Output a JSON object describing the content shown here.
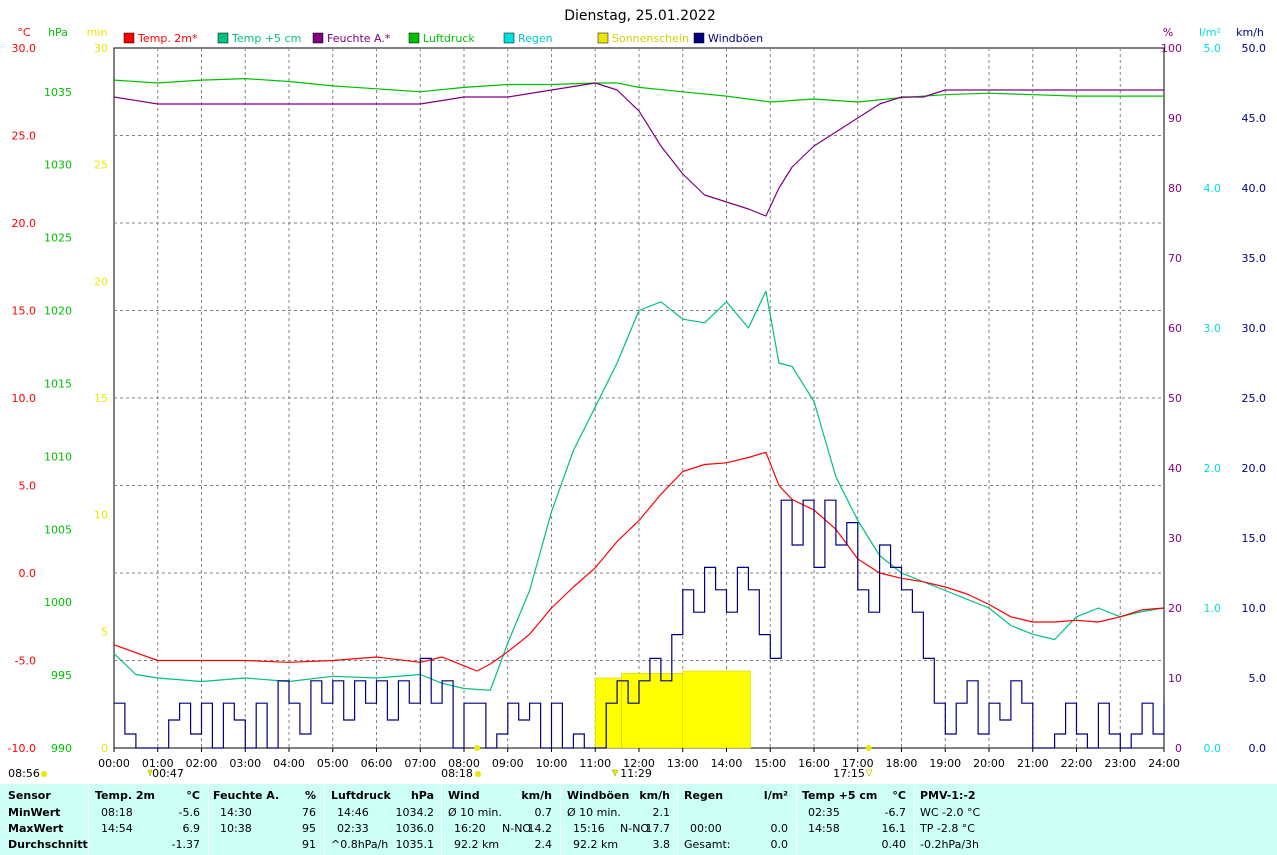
{
  "chart_data": {
    "type": "line",
    "title": "Dienstag, 25.01.2022",
    "axes": {
      "temp": {
        "unit": "°C",
        "ticks": [
          "-10.0",
          "-5.0",
          "0.0",
          "5.0",
          "10.0",
          "15.0",
          "20.0",
          "25.0",
          "30.0"
        ],
        "color": "#ff0000",
        "range": [
          -10,
          30
        ]
      },
      "pressure": {
        "unit": "hPa",
        "ticks": [
          "990",
          "995",
          "1000",
          "1005",
          "1010",
          "1015",
          "1020",
          "1025",
          "1030",
          "1035"
        ],
        "color": "#00c000",
        "range": [
          990,
          1038
        ]
      },
      "sunshine": {
        "unit": "min",
        "ticks": [
          "0",
          "5",
          "10",
          "15",
          "20",
          "25",
          "30"
        ],
        "color": "#e8e800",
        "range": [
          0,
          30
        ]
      },
      "humidity": {
        "unit": "%",
        "ticks": [
          "0",
          "10",
          "20",
          "30",
          "40",
          "50",
          "60",
          "70",
          "80",
          "90",
          "100"
        ],
        "color": "#800080",
        "range": [
          0,
          100
        ]
      },
      "rain": {
        "unit": "l/m²",
        "ticks": [
          "0.0",
          "1.0",
          "2.0",
          "3.0",
          "4.0",
          "5.0"
        ],
        "color": "#00e0e0",
        "range": [
          0,
          5
        ]
      },
      "wind": {
        "unit": "km/h",
        "ticks": [
          "0.0",
          "5.0",
          "10.0",
          "15.0",
          "20.0",
          "25.0",
          "30.0",
          "35.0",
          "40.0",
          "45.0",
          "50.0"
        ],
        "color": "#000080",
        "range": [
          0,
          50
        ]
      }
    },
    "x_ticks": [
      "00:00",
      "01:00",
      "02:00",
      "03:00",
      "04:00",
      "05:00",
      "06:00",
      "07:00",
      "08:00",
      "09:00",
      "10:00",
      "11:00",
      "12:00",
      "13:00",
      "14:00",
      "15:00",
      "16:00",
      "17:00",
      "18:00",
      "19:00",
      "20:00",
      "21:00",
      "22:00",
      "23:00",
      "24:00"
    ],
    "legend": [
      {
        "name": "Temp. 2m*",
        "color": "#ff0000"
      },
      {
        "name": "Temp +5 cm",
        "color": "#00c080"
      },
      {
        "name": "Feuchte A.*",
        "color": "#800080"
      },
      {
        "name": "Luftdruck",
        "color": "#00c000"
      },
      {
        "name": "Regen",
        "color": "#00e0e0"
      },
      {
        "name": "Sonnenschein",
        "color": "#e8e800"
      },
      {
        "name": "Windböen",
        "color": "#000080"
      }
    ],
    "sun_markers": [
      {
        "label": "08:56",
        "time": "08:56"
      },
      {
        "label": "00:47",
        "time": "00:47"
      },
      {
        "label": "08:18",
        "time": "08:18"
      },
      {
        "label": "11:29",
        "time": "11:29"
      },
      {
        "label": "17:15",
        "time": "17:15"
      }
    ],
    "series": [
      {
        "name": "Temp. 2m*",
        "axis": "temp",
        "color": "#ff0000",
        "x": [
          0,
          1,
          2,
          3,
          4,
          5,
          6,
          7,
          7.5,
          8,
          8.3,
          8.6,
          9,
          9.5,
          10,
          10.5,
          11,
          11.5,
          12,
          12.5,
          13,
          13.5,
          14,
          14.5,
          14.9,
          15.2,
          15.5,
          16,
          16.5,
          17,
          17.5,
          18,
          18.5,
          19,
          19.5,
          20,
          20.5,
          21,
          21.5,
          22,
          22.5,
          23,
          23.5,
          24
        ],
        "y": [
          -4.1,
          -5.0,
          -5.0,
          -5.0,
          -5.1,
          -5.0,
          -4.8,
          -5.1,
          -4.8,
          -5.3,
          -5.6,
          -5.2,
          -4.5,
          -3.5,
          -2.0,
          -0.8,
          0.3,
          1.8,
          3.0,
          4.5,
          5.8,
          6.2,
          6.3,
          6.6,
          6.9,
          5.0,
          4.2,
          3.6,
          2.5,
          0.8,
          0.0,
          -0.3,
          -0.5,
          -0.8,
          -1.2,
          -1.8,
          -2.5,
          -2.8,
          -2.8,
          -2.7,
          -2.8,
          -2.5,
          -2.1,
          -2.0
        ]
      },
      {
        "name": "Temp +5 cm",
        "axis": "temp",
        "color": "#00c080",
        "x": [
          0,
          0.5,
          1,
          2,
          3,
          4,
          5,
          6,
          7,
          7.5,
          8,
          8.6,
          9,
          9.5,
          10,
          10.5,
          11,
          11.5,
          12,
          12.5,
          13,
          13.5,
          14,
          14.5,
          14.9,
          15.2,
          15.5,
          16,
          16.5,
          17,
          17.5,
          18,
          18.5,
          19,
          19.5,
          20,
          20.5,
          21,
          21.5,
          22,
          22.5,
          23,
          23.5,
          24
        ],
        "y": [
          -4.6,
          -5.8,
          -6.0,
          -6.2,
          -6.0,
          -6.2,
          -5.9,
          -6.0,
          -5.8,
          -6.3,
          -6.6,
          -6.7,
          -4.0,
          -1.0,
          3.5,
          7.0,
          9.5,
          12.0,
          15.0,
          15.5,
          14.5,
          14.3,
          15.5,
          14.0,
          16.1,
          12.0,
          11.8,
          9.8,
          5.5,
          3.0,
          1.0,
          0.0,
          -0.5,
          -1.0,
          -1.5,
          -2.0,
          -3.0,
          -3.5,
          -3.8,
          -2.5,
          -2.0,
          -2.5,
          -2.2,
          -2.0
        ]
      },
      {
        "name": "Feuchte A.*",
        "axis": "humidity",
        "color": "#800080",
        "x": [
          0,
          1,
          2,
          3,
          4,
          5,
          6,
          7,
          8,
          9,
          10,
          11,
          11.5,
          12,
          12.5,
          13,
          13.5,
          14,
          14.5,
          14.9,
          15.2,
          15.5,
          16,
          16.5,
          17,
          17.5,
          18,
          18.5,
          19,
          20,
          21,
          22,
          23,
          24
        ],
        "y": [
          93,
          92,
          92,
          92,
          92,
          92,
          92,
          92,
          93,
          93,
          94,
          95,
          94,
          91,
          86,
          82,
          79,
          78,
          77,
          76,
          80,
          83,
          86,
          88,
          90,
          92,
          93,
          93,
          94,
          94,
          94,
          94,
          94,
          94
        ]
      },
      {
        "name": "Luftdruck",
        "axis": "pressure",
        "color": "#00c000",
        "x": [
          0,
          1,
          2,
          3,
          4,
          5,
          6,
          7,
          8,
          9,
          10,
          11,
          11.5,
          12,
          13,
          14,
          15,
          16,
          17,
          18,
          19,
          20,
          21,
          22,
          23,
          24
        ],
        "y": [
          1035.8,
          1035.6,
          1035.8,
          1035.9,
          1035.7,
          1035.4,
          1035.2,
          1035.0,
          1035.3,
          1035.5,
          1035.5,
          1035.6,
          1035.6,
          1035.3,
          1035.0,
          1034.7,
          1034.3,
          1034.5,
          1034.3,
          1034.6,
          1034.8,
          1034.9,
          1034.8,
          1034.7,
          1034.7,
          1034.7
        ]
      }
    ],
    "sunshine_bars": [
      {
        "from": 11.0,
        "to": 11.6,
        "minutes": 3.0
      },
      {
        "from": 11.6,
        "to": 13.0,
        "minutes": 3.2
      },
      {
        "from": 13.0,
        "to": 14.55,
        "minutes": 3.3
      }
    ],
    "windgusts": {
      "name": "Windböen",
      "axis": "wind",
      "color": "#000080",
      "x": [
        0,
        0.25,
        0.5,
        0.75,
        1,
        1.25,
        1.5,
        1.75,
        2,
        2.25,
        2.5,
        2.75,
        3,
        3.25,
        3.5,
        3.75,
        4,
        4.25,
        4.5,
        4.75,
        5,
        5.25,
        5.5,
        5.75,
        6,
        6.25,
        6.5,
        6.75,
        7,
        7.25,
        7.5,
        7.75,
        8,
        8.25,
        8.5,
        8.75,
        9,
        9.25,
        9.5,
        9.75,
        10,
        10.25,
        10.5,
        10.75,
        11,
        11.25,
        11.5,
        11.75,
        12,
        12.25,
        12.5,
        12.75,
        13,
        13.25,
        13.5,
        13.75,
        14,
        14.25,
        14.5,
        14.75,
        15,
        15.25,
        15.5,
        15.75,
        16,
        16.25,
        16.5,
        16.75,
        17,
        17.25,
        17.5,
        17.75,
        18,
        18.25,
        18.5,
        18.75,
        19,
        19.25,
        19.5,
        19.75,
        20,
        20.25,
        20.5,
        20.75,
        21,
        21.25,
        21.5,
        21.75,
        22,
        22.25,
        22.5,
        22.75,
        23,
        23.25,
        23.5,
        23.75,
        24
      ],
      "y": [
        3.2,
        1.0,
        0,
        0,
        0,
        2.0,
        3.2,
        1.0,
        3.2,
        0,
        3.2,
        2.0,
        0,
        3.2,
        0,
        4.8,
        3.2,
        1.0,
        4.8,
        3.2,
        4.8,
        2.0,
        4.8,
        3.2,
        4.8,
        2.0,
        4.8,
        3.2,
        6.4,
        3.2,
        4.8,
        0,
        3.2,
        3.2,
        0,
        1.0,
        3.2,
        2.0,
        3.2,
        0,
        3.2,
        0,
        1.0,
        0,
        0,
        3.2,
        4.8,
        3.2,
        4.8,
        6.4,
        4.8,
        8.1,
        11.3,
        9.7,
        12.9,
        11.3,
        9.7,
        12.9,
        11.3,
        8.1,
        6.4,
        17.7,
        14.5,
        17.7,
        12.9,
        17.7,
        14.5,
        16.1,
        11.3,
        9.7,
        14.5,
        12.9,
        11.3,
        9.7,
        6.4,
        3.2,
        1.0,
        3.2,
        4.8,
        1.0,
        3.2,
        2.0,
        4.8,
        3.2,
        0,
        0,
        1.0,
        3.2,
        1.0,
        0,
        3.2,
        1.0,
        0,
        1.0,
        3.2,
        1.0,
        3.2,
        1.0,
        0
      ]
    }
  },
  "stats": {
    "sensor": {
      "label": "Sensor",
      "rows": [
        "MinWert",
        "MaxWert",
        "Durchschnitt"
      ]
    },
    "temp2m": {
      "title": "Temp. 2m",
      "unit": "°C",
      "min_time": "08:18",
      "min": "-5.6",
      "max_time": "14:54",
      "max": "6.9",
      "avg": "-1.37"
    },
    "feuchte": {
      "title": "Feuchte A.",
      "unit": "%",
      "min_time": "14:30",
      "min": "76",
      "max_time": "10:38",
      "max": "95",
      "avg": "91"
    },
    "luftdruck": {
      "title": "Luftdruck",
      "unit": "hPa",
      "min_time": "14:46",
      "min": "1034.2",
      "max_time": "02:33",
      "max": "1036.0",
      "avg_label": "^0.8hPa/h",
      "avg": "1035.1"
    },
    "wind": {
      "title": "Wind",
      "unit": "km/h",
      "r1_label": "Ø 10 min.",
      "r1": "0.7",
      "r2_time": "16:20",
      "r2_dir": "N-NO",
      "r2": "14.2",
      "r3_label": "92.2 km",
      "r3": "2.4"
    },
    "windboeen": {
      "title": "Windböen",
      "unit": "km/h",
      "r1_label": "Ø 10 min.",
      "r1": "2.1",
      "r2_time": "15:16",
      "r2_dir": "N-NO",
      "r2": "17.7",
      "r3_label": "92.2 km",
      "r3": "3.8"
    },
    "regen": {
      "title": "Regen",
      "unit": "l/m²",
      "r2_time": "00:00",
      "r2": "0.0",
      "r3_label": "Gesamt:",
      "r3": "0.0"
    },
    "temp5cm": {
      "title": "Temp +5 cm",
      "unit": "°C",
      "min_time": "02:35",
      "min": "-6.7",
      "max_time": "14:58",
      "max": "16.1",
      "avg": "0.40"
    },
    "pmv": {
      "title": "PMV-1:-2",
      "r1": "WC -2.0 °C",
      "r2": "TP -2.8 °C",
      "r3": "-0.2hPa/3h"
    }
  }
}
